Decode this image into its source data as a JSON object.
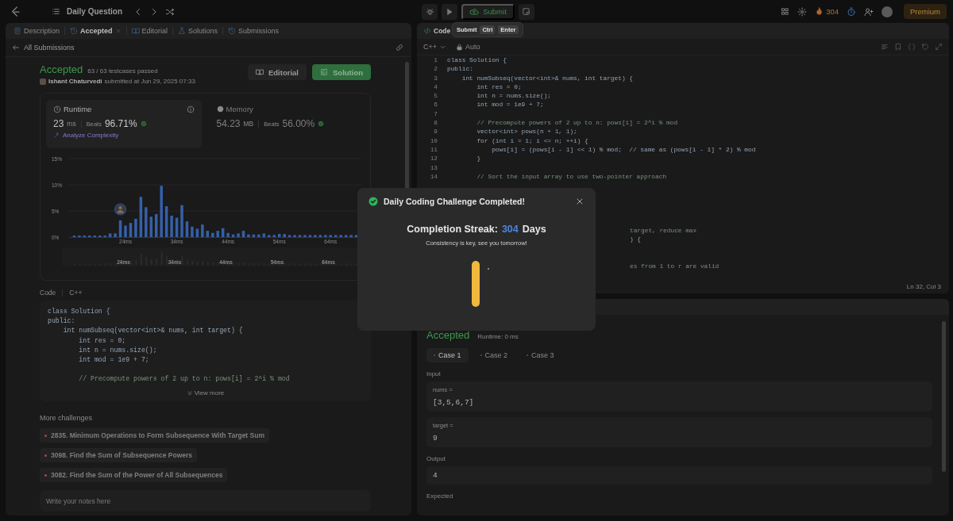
{
  "top_bar": {
    "title": "Daily Question",
    "submit": "Submit",
    "streak": "304",
    "premium": "Premium"
  },
  "tooltip": {
    "label": "Submit",
    "keys": [
      "Ctrl",
      "Enter"
    ]
  },
  "left_panel": {
    "tabs": [
      {
        "label": "Description",
        "selected": false,
        "closable": false
      },
      {
        "label": "Accepted",
        "selected": true,
        "closable": true
      },
      {
        "label": "Editorial",
        "selected": false,
        "closable": false
      },
      {
        "label": "Solutions",
        "selected": false,
        "closable": false
      },
      {
        "label": "Submissions",
        "selected": false,
        "closable": false
      }
    ],
    "back_link": "All Submissions",
    "submission": {
      "status": "Accepted",
      "testcases": "63 / 63 testcases passed",
      "author": "Ishant Chaturvedi",
      "submitted": "submitted at Jun 29, 2025 07:33",
      "buttons": [
        {
          "label": "Editorial",
          "kind": "secondary"
        },
        {
          "label": "Solution",
          "kind": "primary"
        }
      ]
    },
    "stats": [
      {
        "kind": "runtime",
        "label": "Runtime",
        "value": "23",
        "unit": "ms",
        "beats_label": "Beats",
        "beats": "96.71%",
        "selected": true,
        "action": "Analyze Complexity"
      },
      {
        "kind": "memory",
        "label": "Memory",
        "value": "54.23",
        "unit": "MB",
        "beats_label": "Beats",
        "beats": "56.00%",
        "selected": false
      }
    ],
    "chart_data": {
      "type": "bar",
      "x": [
        14,
        15,
        16,
        17,
        18,
        19,
        20,
        21,
        22,
        23,
        24,
        25,
        26,
        27,
        28,
        29,
        30,
        31,
        32,
        33,
        34,
        35,
        36,
        37,
        38,
        39,
        40,
        41,
        42,
        43,
        44,
        45,
        46,
        47,
        48,
        49,
        50,
        51,
        52,
        53,
        54,
        55,
        56,
        57,
        58,
        59,
        60,
        61,
        62,
        63,
        64,
        65,
        66,
        67,
        68,
        69
      ],
      "values": [
        0.3,
        0.3,
        0.3,
        0.3,
        0.3,
        0.3,
        0.3,
        0.7,
        0.7,
        3.2,
        2.2,
        2.7,
        3.5,
        7.7,
        5.7,
        3.9,
        4.4,
        9.8,
        5.9,
        4.1,
        3.7,
        6.1,
        3.0,
        2.0,
        1.6,
        2.4,
        1.2,
        0.8,
        1.2,
        1.7,
        0.8,
        0.5,
        0.7,
        1.2,
        0.5,
        0.5,
        0.5,
        0.7,
        0.4,
        0.4,
        0.6,
        0.6,
        0.4,
        0.4,
        0.4,
        0.4,
        0.4,
        0.4,
        0.4,
        0.4,
        0.4,
        0.4,
        0.4,
        0.4,
        0.4,
        0.4
      ],
      "ylim": [
        0,
        15
      ],
      "yticks": [
        {
          "value": 0,
          "label": "0%"
        },
        {
          "value": 5,
          "label": "5%"
        },
        {
          "value": 10,
          "label": "10%"
        },
        {
          "value": 15,
          "label": "15%"
        }
      ],
      "xticks": [
        {
          "value": 24,
          "label": "24ms"
        },
        {
          "value": 34,
          "label": "34ms"
        },
        {
          "value": 44,
          "label": "44ms"
        },
        {
          "value": 54,
          "label": "54ms"
        },
        {
          "value": 64,
          "label": "64ms"
        }
      ],
      "xlim": [
        13,
        70
      ]
    },
    "brush_labels": [
      "24ms",
      "34ms",
      "44ms",
      "54ms",
      "64ms"
    ],
    "code_header": {
      "title": "Code",
      "language": "C++"
    },
    "code": [
      {
        "kind": "code",
        "text": "class Solution {"
      },
      {
        "kind": "code",
        "text": "public:"
      },
      {
        "kind": "code",
        "text": "    int numSubseq(vector<int>& nums, int target) {"
      },
      {
        "kind": "code",
        "text": "        int res = 0;"
      },
      {
        "kind": "code",
        "text": "        int n = nums.size();"
      },
      {
        "kind": "code",
        "text": "        int mod = 1e9 + 7;"
      },
      {
        "kind": "blank"
      },
      {
        "kind": "comment",
        "text": "        // Precompute powers of 2 up to n: pows[i] = 2^i % mod"
      }
    ],
    "view_more": "View more",
    "more_title": "More challenges",
    "challenges": [
      {
        "title": "2835. Minimum Operations to Form Subsequence With Target Sum",
        "color": "#b8413f"
      },
      {
        "title": "3098. Find the Sum of Subsequence Powers",
        "color": "#b8413f"
      },
      {
        "title": "3082. Find the Sum of the Power of All Subsequences",
        "color": "#b8413f"
      }
    ],
    "notes": {
      "placeholder": "Write your notes here"
    }
  },
  "editor": {
    "tab": "Code",
    "language": "C++",
    "mode": "Auto",
    "lines": [
      {
        "n": "1",
        "kind": "code",
        "text": "class Solution {"
      },
      {
        "n": "2",
        "kind": "code",
        "text": "public:"
      },
      {
        "n": "3",
        "kind": "code",
        "text": "    int numSubseq(vector<int>& nums, int target) {"
      },
      {
        "n": "4",
        "kind": "code",
        "text": "        int res = 0;"
      },
      {
        "n": "5",
        "kind": "code",
        "text": "        int n = nums.size();"
      },
      {
        "n": "6",
        "kind": "code",
        "text": "        int mod = 1e9 + 7;"
      },
      {
        "n": "7",
        "kind": "blank"
      },
      {
        "n": "8",
        "kind": "comment",
        "text": "        // Precompute powers of 2 up to n: pows[i] = 2^i % mod"
      },
      {
        "n": "9",
        "kind": "code",
        "text": "        vector<int> pows(n + 1, 1);"
      },
      {
        "n": "10",
        "kind": "code",
        "text": "        for (int i = 1; i <= n; ++i) {"
      },
      {
        "n": "11",
        "kind": "code",
        "text": "            pows[i] = (pows[i - 1] << 1) % mod;  // same as (pows[i - 1] * 2) % mod"
      },
      {
        "n": "12",
        "kind": "code",
        "text": "        }"
      },
      {
        "n": "13",
        "kind": "blank"
      },
      {
        "n": "14",
        "kind": "comment",
        "text": "        // Sort the input array to use two-pointer approach"
      }
    ],
    "hidden_lines": [
      {
        "kind": "blank"
      },
      {
        "kind": "blank"
      },
      {
        "kind": "blank"
      },
      {
        "kind": "blank"
      },
      {
        "kind": "blank"
      },
      {
        "kind": "comment",
        "text": "target, reduce max"
      },
      {
        "kind": "code",
        "text": ") {"
      },
      {
        "kind": "blank"
      },
      {
        "kind": "blank"
      },
      {
        "kind": "comment",
        "text": "es from 1 to r are valid"
      }
    ],
    "status": "Ln 32, Col 3"
  },
  "result": {
    "status": "Accepted",
    "runtime": "Runtime: 0 ms",
    "cases": [
      {
        "label": "Case 1",
        "selected": true
      },
      {
        "label": "Case 2",
        "selected": false
      },
      {
        "label": "Case 3",
        "selected": false
      }
    ],
    "input_label": "Input",
    "inputs": [
      {
        "name": "nums =",
        "value": "[3,5,6,7]"
      },
      {
        "name": "target =",
        "value": "9"
      }
    ],
    "output_label": "Output",
    "output": "4",
    "expected_label": "Expected"
  },
  "modal": {
    "title": "Daily Coding Challenge Completed!",
    "streak_label": "Completion Streak:",
    "streak": "304",
    "streak_unit": "Days",
    "message": "Consistency is key, see you tomorrow!"
  }
}
